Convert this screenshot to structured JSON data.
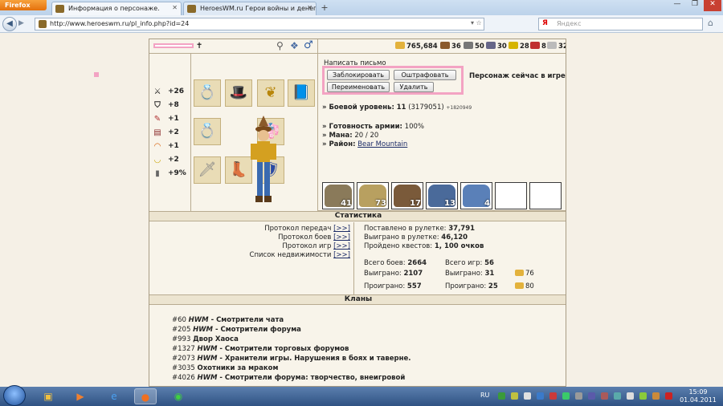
{
  "browser": {
    "app_button": "Firefox",
    "tabs": [
      {
        "label": "Информация о персонаже."
      },
      {
        "label": "HeroesWM.ru Герои войны и денег..."
      }
    ],
    "new_tab": "+",
    "url": "http://www.heroeswm.ru/pl_info.php?id=24",
    "search_placeholder": "Яндекс",
    "search_engine_letter": "Я"
  },
  "resources": [
    {
      "icon": "gold-icon",
      "value": "765,684",
      "color": "#e3b23c"
    },
    {
      "icon": "wood-icon",
      "value": "36",
      "color": "#8b5a2b"
    },
    {
      "icon": "ore-icon",
      "value": "50",
      "color": "#777777"
    },
    {
      "icon": "mercury-icon",
      "value": "30",
      "color": "#666688"
    },
    {
      "icon": "sulfur-icon",
      "value": "28",
      "color": "#d6b400"
    },
    {
      "icon": "crystal-icon",
      "value": "8",
      "color": "#c03030"
    },
    {
      "icon": "gems-icon",
      "value": "32",
      "color": "#cccccc"
    }
  ],
  "stats": [
    {
      "icon": "attack-icon",
      "value": "+26"
    },
    {
      "icon": "defense-icon",
      "value": "+8"
    },
    {
      "icon": "spellpower-icon",
      "value": "+1"
    },
    {
      "icon": "knowledge-icon",
      "value": "+2"
    },
    {
      "icon": "luck-icon",
      "value": "+1"
    },
    {
      "icon": "morale-icon",
      "value": "+2"
    },
    {
      "icon": "initiative-icon",
      "value": "+9%"
    }
  ],
  "actions": {
    "write_message": "Написать письмо",
    "block": "Заблокировать",
    "fine": "Оштрафовать",
    "rename": "Переименовать",
    "delete": "Удалить",
    "status": "Персонаж сейчас в игре"
  },
  "character": {
    "level_label": "» Боевой уровень:",
    "level": "11",
    "exp": "(3179051)",
    "exp_extra": "+1820949",
    "army_label": "» Готовность армии:",
    "army": "100%",
    "mana_label": "» Мана:",
    "mana": "20 / 20",
    "district_label": "» Район:",
    "district": "Bear Mountain"
  },
  "army_counts": [
    "41",
    "73",
    "17",
    "13",
    "4",
    "",
    ""
  ],
  "statistics": {
    "header": "Статистика",
    "protocols": [
      {
        "label": "Протокол передач",
        "link": "[>>]"
      },
      {
        "label": "Протокол боев",
        "link": "[>>]"
      },
      {
        "label": "Протокол игр",
        "link": "[>>]"
      },
      {
        "label": "Список недвижимости",
        "link": "[>>]"
      }
    ],
    "roulette_bet_label": "Поставлено в рулетке:",
    "roulette_bet": "37,791",
    "roulette_won_label": "Выиграно в рулетке:",
    "roulette_won": "46,120",
    "quests_label": "Пройдено квестов:",
    "quests": "1, 100 очков",
    "battles_total_label": "Всего боев:",
    "battles_total": "2664",
    "games_total_label": "Всего игр:",
    "games_total": "56",
    "battles_won_label": "Выиграно:",
    "battles_won": "2107",
    "games_won_label": "Выиграно:",
    "games_won": "31",
    "games_won_gold": "76",
    "battles_lost_label": "Проиграно:",
    "battles_lost": "557",
    "games_lost_label": "Проиграно:",
    "games_lost": "25",
    "games_lost_gold": "80"
  },
  "clans": {
    "header": "Кланы",
    "items": [
      {
        "id": "#60",
        "tag": "HWM",
        "sep": " - ",
        "name": "Смотрители чата"
      },
      {
        "id": "#205",
        "tag": "HWM",
        "sep": " - ",
        "name": "Смотрители форума"
      },
      {
        "id": "#993",
        "tag": "",
        "sep": " ",
        "name": "Двор Хаоса"
      },
      {
        "id": "#1327",
        "tag": "HWM",
        "sep": " - ",
        "name": "Смотрители торговых форумов"
      },
      {
        "id": "#2073",
        "tag": "HWM",
        "sep": " - ",
        "name": "Хранители игры. Нарушения в боях и таверне."
      },
      {
        "id": "#3035",
        "tag": "",
        "sep": " ",
        "name": "Охотники за мраком"
      },
      {
        "id": "#4026",
        "tag": "HWM",
        "sep": " - ",
        "name": "Смотрители форума: творчество, внеигровой"
      }
    ]
  },
  "taskbar": {
    "lang": "RU",
    "time": "15:09",
    "date": "01.04.2011"
  }
}
